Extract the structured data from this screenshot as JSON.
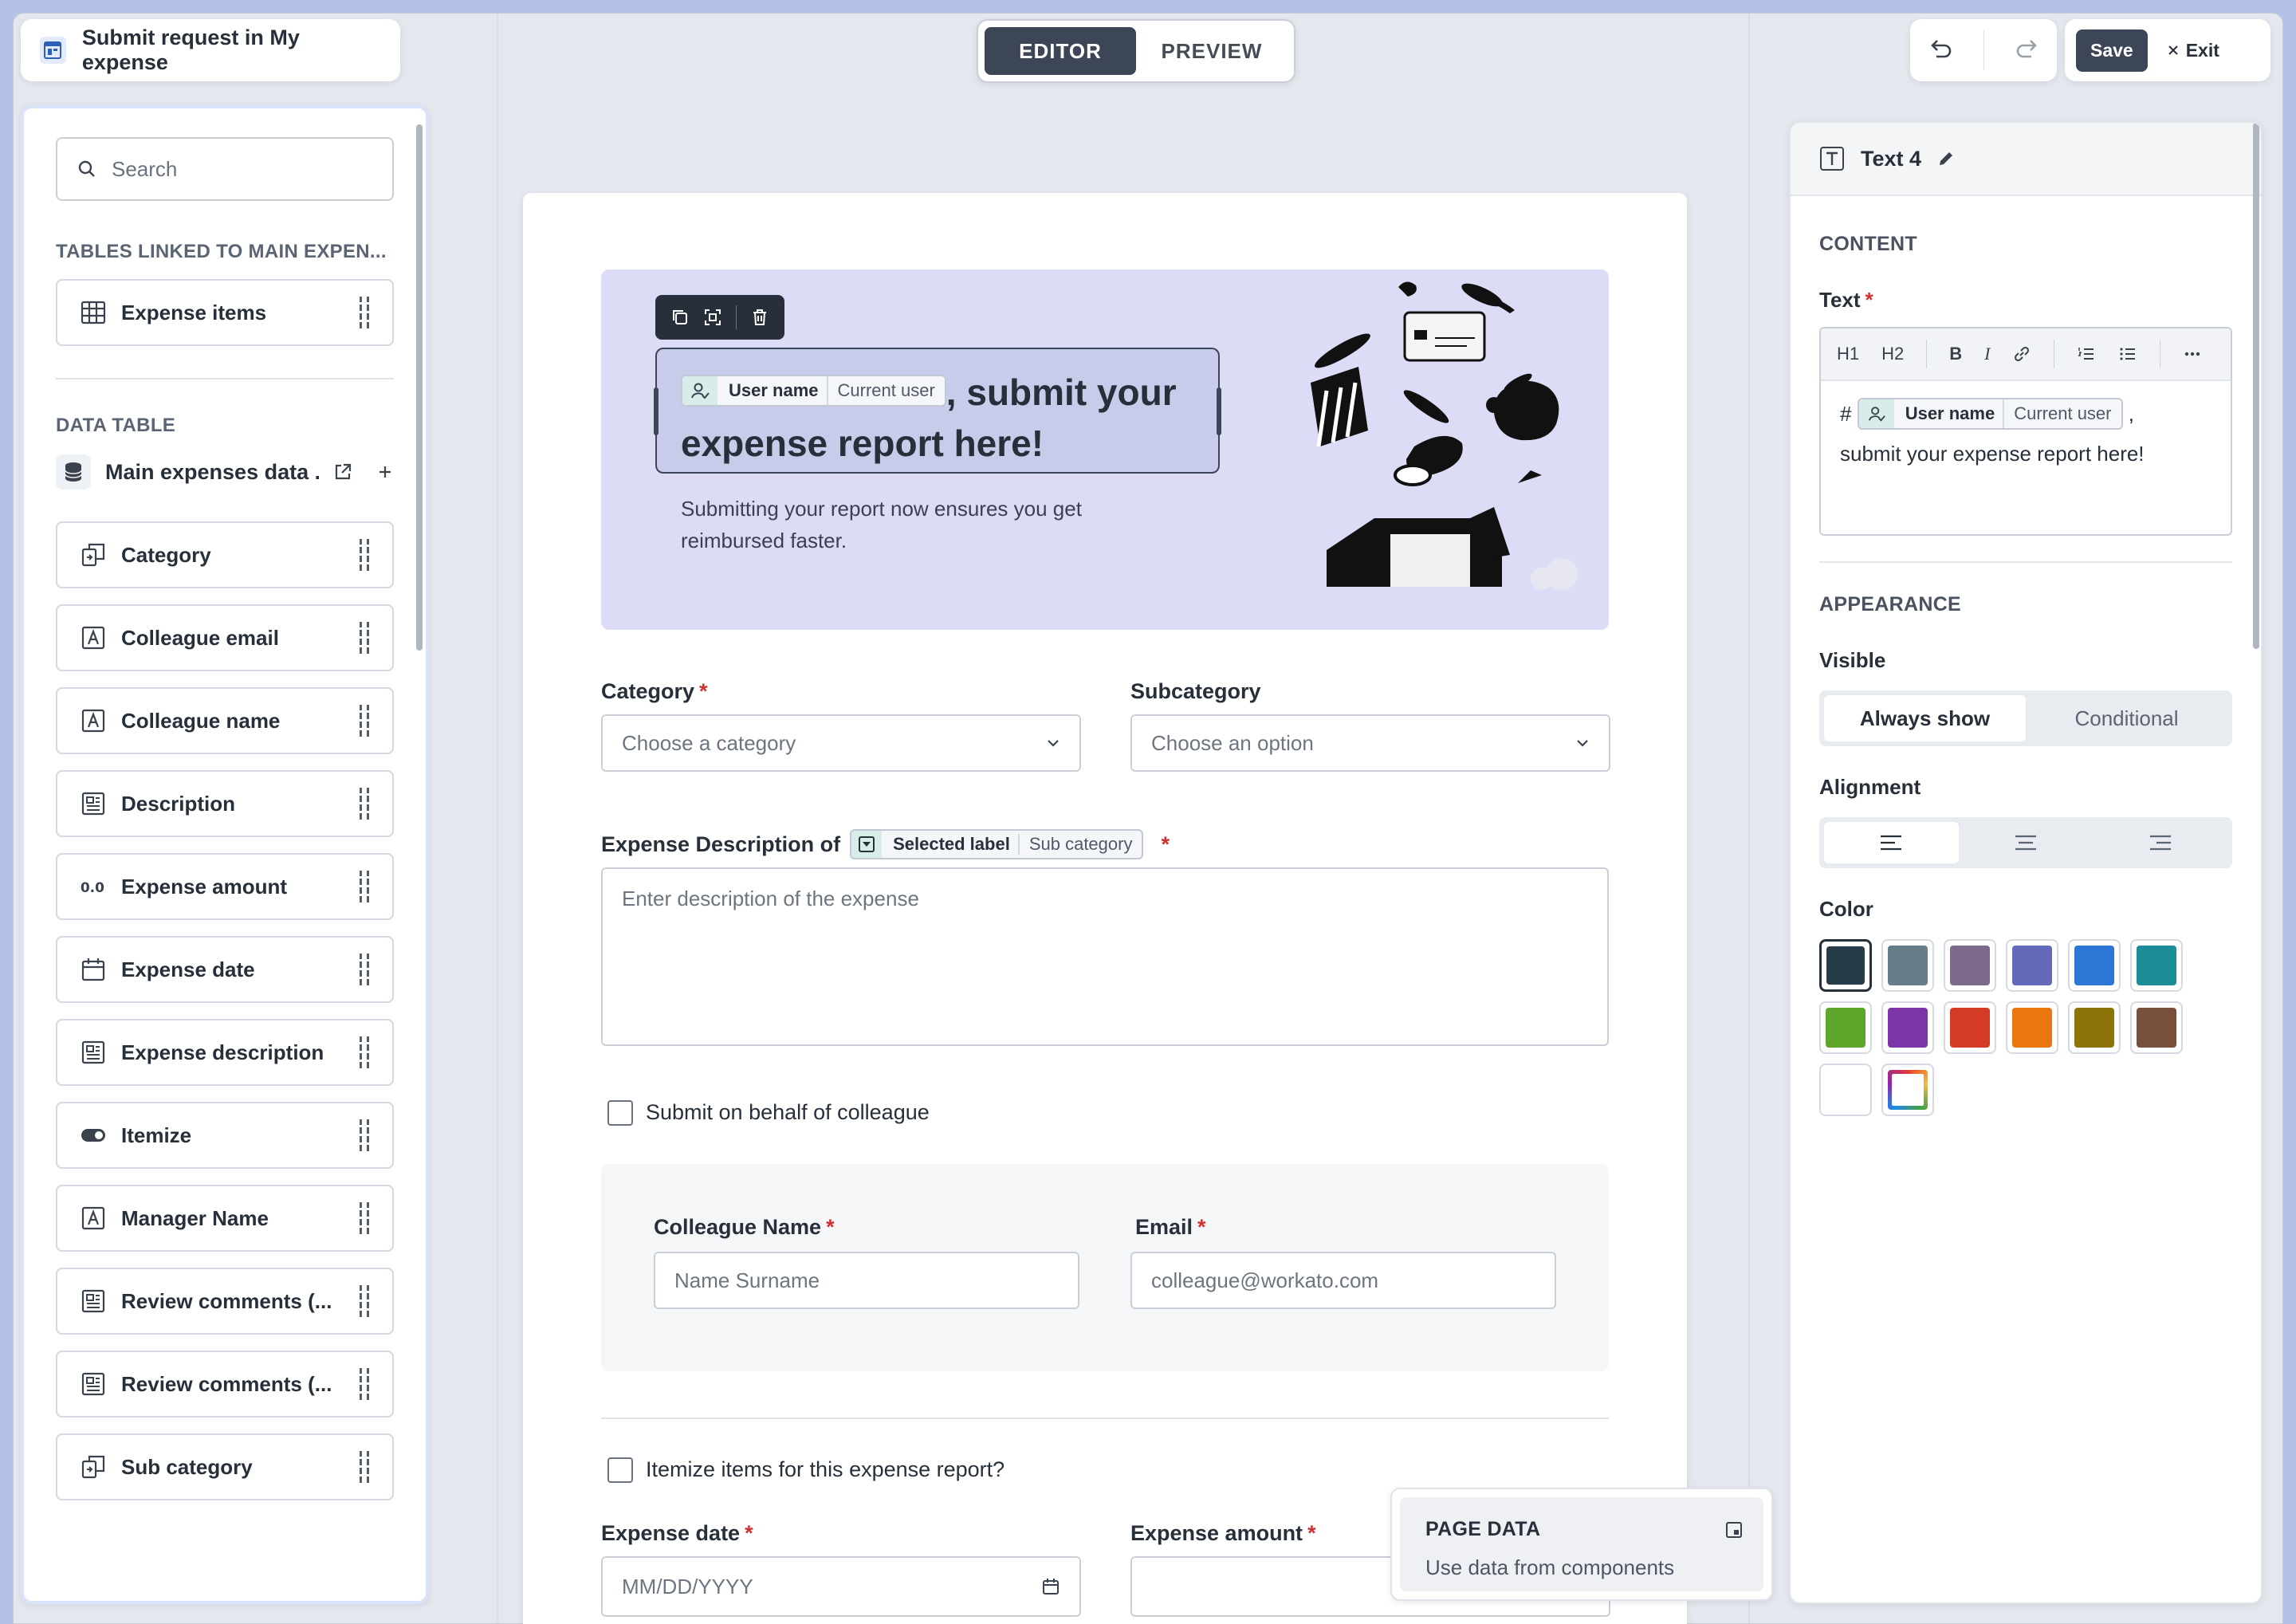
{
  "header": {
    "title": "Submit request in My expense",
    "modes": [
      "EDITOR",
      "PREVIEW"
    ],
    "active_mode": "EDITOR",
    "save_label": "Save",
    "exit_label": "Exit"
  },
  "left_panel": {
    "search_placeholder": "Search",
    "linked_section": "TABLES LINKED TO MAIN EXPEN...",
    "linked_items": [
      {
        "label": "Expense items",
        "icon": "table-icon"
      }
    ],
    "data_section": "DATA TABLE",
    "data_table_name": "Main expenses data ...",
    "fields": [
      {
        "label": "Category",
        "icon": "relation-icon"
      },
      {
        "label": "Colleague email",
        "icon": "text-field-icon"
      },
      {
        "label": "Colleague name",
        "icon": "text-field-icon"
      },
      {
        "label": "Description",
        "icon": "long-text-icon"
      },
      {
        "label": "Expense amount",
        "icon": "number-icon"
      },
      {
        "label": "Expense date",
        "icon": "calendar-icon"
      },
      {
        "label": "Expense description",
        "icon": "long-text-icon"
      },
      {
        "label": "Itemize",
        "icon": "toggle-icon"
      },
      {
        "label": "Manager Name",
        "icon": "text-field-icon"
      },
      {
        "label": "Review comments (...",
        "icon": "long-text-icon"
      },
      {
        "label": "Review comments (...",
        "icon": "long-text-icon"
      },
      {
        "label": "Sub category",
        "icon": "relation-icon"
      }
    ]
  },
  "form": {
    "hero": {
      "chip_label": "User name",
      "chip_value": "Current user",
      "heading_rest": ", submit your expense report here!",
      "subtext": "Submitting your report now ensures you get reimbursed faster."
    },
    "category_label": "Category",
    "category_placeholder": "Choose a category",
    "subcategory_label": "Subcategory",
    "subcategory_placeholder": "Choose an option",
    "description_label": "Expense Description of",
    "description_chip_label": "Selected label",
    "description_chip_value": "Sub category",
    "description_placeholder": "Enter description of the expense",
    "behalf_label": "Submit on behalf of colleague",
    "colleague_name_label": "Colleague Name",
    "colleague_name_placeholder": "Name Surname",
    "email_label": "Email",
    "email_placeholder": "colleague@workato.com",
    "itemize_label": "Itemize items for this expense report?",
    "expense_date_label": "Expense date",
    "expense_date_placeholder": "MM/DD/YYYY",
    "expense_amount_label": "Expense amount"
  },
  "page_data": {
    "title": "PAGE DATA",
    "subtitle": "Use data from components"
  },
  "right_panel": {
    "component_name": "Text 4",
    "content_section": "CONTENT",
    "text_label": "Text",
    "editor_prefix": "#",
    "editor_chip_label": "User name",
    "editor_chip_value": "Current user",
    "editor_after_chip": ",",
    "editor_line2": "submit your expense report here!",
    "toolbar": [
      "H1",
      "H2",
      "B",
      "I"
    ],
    "appearance_section": "APPEARANCE",
    "visible_label": "Visible",
    "visible_options": [
      "Always show",
      "Conditional"
    ],
    "alignment_label": "Alignment",
    "color_label": "Color",
    "colors": [
      "#263c48",
      "#677d87",
      "#7b6a8c",
      "#636aba",
      "#2c77d6",
      "#1c8c96",
      "#5ea52c",
      "#7c35a6",
      "#d53b26",
      "#e9760f",
      "#8c7408",
      "#784f3a",
      "#ffffff"
    ]
  }
}
